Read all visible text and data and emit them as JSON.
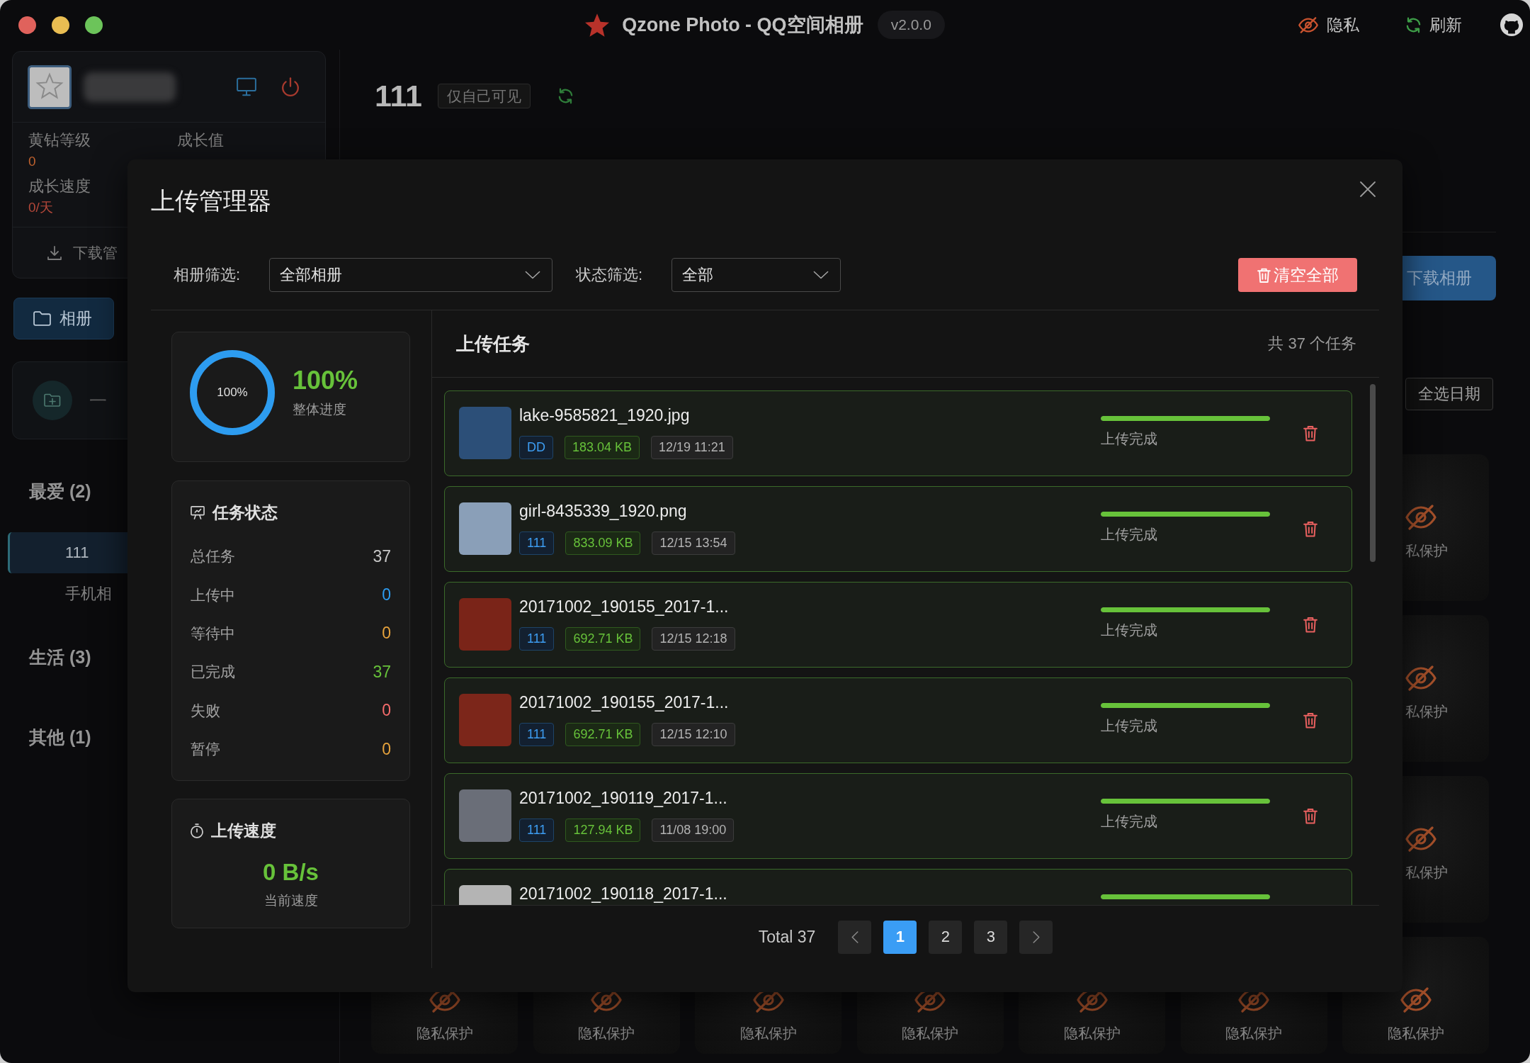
{
  "window": {
    "title": "Qzone Photo - QQ空间相册",
    "version": "v2.0.0",
    "actions": [
      {
        "kind": "privacy",
        "label": "隐私"
      },
      {
        "kind": "refresh",
        "label": "刷新"
      },
      {
        "kind": "github"
      }
    ]
  },
  "sidebar": {
    "profile": {
      "stats": [
        {
          "label": "黄钻等级",
          "value": "0",
          "color": "#c0622e"
        },
        {
          "label": "成长值"
        },
        {
          "label": "成长速度",
          "value": "0/天",
          "color": "#b5483a"
        }
      ],
      "download_manager": "下载管"
    },
    "nav": [
      {
        "label": "相册",
        "selected": true
      }
    ],
    "quick_action": "一",
    "groups": [
      {
        "name": "最爱 (2)",
        "items": [
          {
            "label": "111",
            "selected": true
          },
          {
            "label": "手机相",
            "selected": false
          }
        ]
      },
      {
        "name": "生活 (3)"
      },
      {
        "name": "其他 (1)"
      }
    ]
  },
  "main": {
    "album_title": "111",
    "visibility": "仅自己可见",
    "download_button": "下载相册",
    "select_dates_button": "全选日期",
    "photos": {
      "right_column": [
        {
          "label": "私保护"
        },
        {
          "label": "私保护"
        },
        {
          "label": "私保护"
        }
      ],
      "bottom_row": [
        {
          "label": "隐私保护"
        },
        {
          "label": "隐私保护"
        },
        {
          "label": "隐私保护"
        },
        {
          "label": "隐私保护"
        },
        {
          "label": "隐私保护"
        },
        {
          "label": "隐私保护"
        },
        {
          "label": "隐私保护"
        }
      ]
    }
  },
  "upload_manager": {
    "title": "上传管理器",
    "filters": [
      {
        "label": "相册筛选:",
        "value": "全部相册"
      },
      {
        "label": "状态筛选:",
        "value": "全部"
      }
    ],
    "clear_button": "清空全部",
    "overall": {
      "level": 1,
      "ring_label": "100%",
      "percent": "100%",
      "caption": "整体进度"
    },
    "status": {
      "title": "任务状态",
      "rows": [
        {
          "label": "总任务",
          "value": "37",
          "color": "#c8c8c8"
        },
        {
          "label": "上传中",
          "value": "0",
          "color": "#2d9cf0"
        },
        {
          "label": "等待中",
          "value": "0",
          "color": "#e6a23c"
        },
        {
          "label": "已完成",
          "value": "37",
          "color": "#67c23a"
        },
        {
          "label": "失败",
          "value": "0",
          "color": "#f56c6c"
        },
        {
          "label": "暂停",
          "value": "0",
          "color": "#e6a23c"
        }
      ]
    },
    "speed": {
      "title": "上传速度",
      "value": "0 B/s",
      "caption": "当前速度"
    },
    "tasks": {
      "title": "上传任务",
      "count": "共 37 个任务",
      "items": [
        {
          "name": "lake-9585821_1920.jpg",
          "color": "#2c4f78",
          "album": "DD",
          "size": "183.04 KB",
          "time": "12/19 11:21",
          "level": 1,
          "status": "上传完成"
        },
        {
          "name": "girl-8435339_1920.png",
          "color": "#8a9fb8",
          "album": "111",
          "size": "833.09 KB",
          "time": "12/15 13:54",
          "level": 1,
          "status": "上传完成"
        },
        {
          "name": "20171002_190155_2017-1...",
          "color": "#7a2418",
          "album": "111",
          "size": "692.71 KB",
          "time": "12/15 12:18",
          "level": 1,
          "status": "上传完成"
        },
        {
          "name": "20171002_190155_2017-1...",
          "color": "#7c261a",
          "album": "111",
          "size": "692.71 KB",
          "time": "12/15 12:10",
          "level": 1,
          "status": "上传完成"
        },
        {
          "name": "20171002_190119_2017-1...",
          "color": "#6a6e78",
          "album": "111",
          "size": "127.94 KB",
          "time": "11/08 19:00",
          "level": 1,
          "status": "上传完成"
        },
        {
          "name": "20171002_190118_2017-1...",
          "color": "#b4b4b4",
          "level": 1
        }
      ]
    },
    "pagination": {
      "total": "Total 37",
      "pages": [
        {
          "label": "1",
          "selected": true
        },
        {
          "label": "2",
          "selected": false
        },
        {
          "label": "3",
          "selected": false
        }
      ]
    }
  }
}
